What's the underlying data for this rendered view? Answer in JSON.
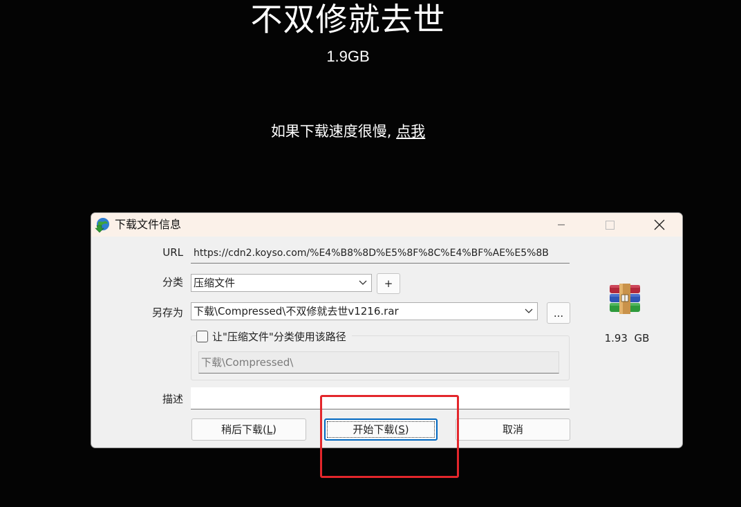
{
  "page": {
    "title": "不双修就去世",
    "size": "1.9GB",
    "slow_text": "如果下载速度很慢,",
    "slow_link": "点我"
  },
  "dialog": {
    "title": "下载文件信息",
    "url_label": "URL",
    "url_value": "https://cdn2.koyso.com/%E4%B8%8D%E5%8F%8C%E4%BF%AE%E5%8B",
    "category_label": "分类",
    "category_value": "压缩文件",
    "add_category_label": "+",
    "save_as_label": "另存为",
    "save_as_value": "下载\\Compressed\\不双修就去世v1216.rar",
    "browse_label": "...",
    "remember_path_label": "让\"压缩文件\"分类使用该路径",
    "category_path_value": "下载\\Compressed\\",
    "description_label": "描述",
    "description_value": "",
    "later_button_text": "稍后下载(",
    "later_button_key": "L",
    "start_button_text": "开始下载(",
    "start_button_key": "S",
    "button_close_paren": ")",
    "cancel_button": "取消",
    "file_size": "1.93  GB",
    "file_icon": "winrar-archive-icon"
  },
  "annotation": {
    "highlight_color": "#e3262b"
  },
  "colors": {
    "page_background": "#040404",
    "dialog_background": "#f0f0f0",
    "titlebar_background": "#fbf1e9",
    "primary_border": "#0067c0"
  }
}
